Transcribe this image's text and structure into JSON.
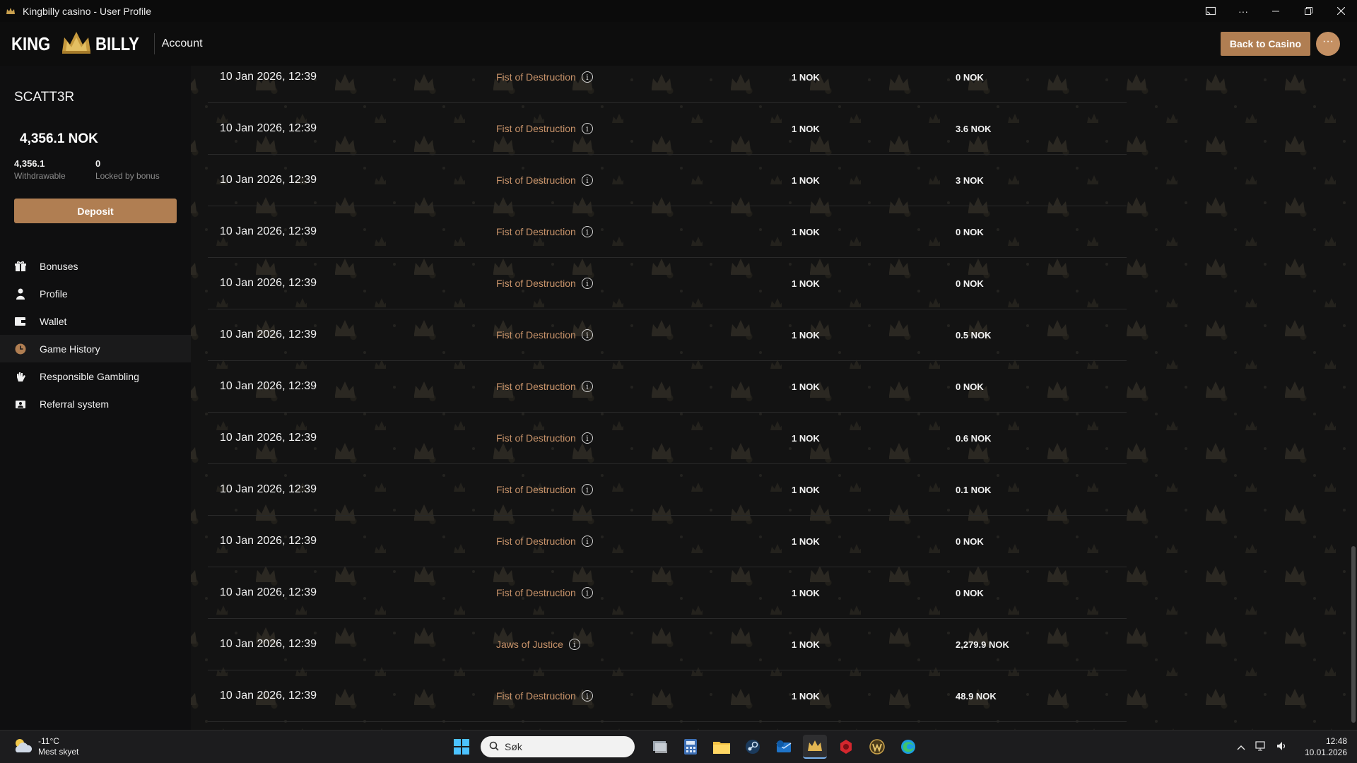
{
  "window": {
    "title": "Kingbilly casino - User Profile"
  },
  "header": {
    "logo_left": "KING",
    "logo_right": "BILLY",
    "section": "Account",
    "back_button": "Back to Casino",
    "more_button": "···"
  },
  "sidebar": {
    "username": "SCATT3R",
    "balance": "4,356.1 NOK",
    "withdrawable_value": "4,356.1",
    "withdrawable_label": "Withdrawable",
    "locked_value": "0",
    "locked_label": "Locked by bonus",
    "deposit_label": "Deposit",
    "items": [
      {
        "label": "Bonuses",
        "icon": "gift-icon"
      },
      {
        "label": "Profile",
        "icon": "user-icon"
      },
      {
        "label": "Wallet",
        "icon": "wallet-icon"
      },
      {
        "label": "Game History",
        "icon": "clock-icon",
        "active": true
      },
      {
        "label": "Responsible Gambling",
        "icon": "hand-icon"
      },
      {
        "label": "Referral system",
        "icon": "referral-icon"
      }
    ]
  },
  "history": {
    "rows": [
      {
        "date": "10 Jan 2026, 12:39",
        "game": "Fist of Destruction",
        "bet": "1 NOK",
        "win": "0 NOK"
      },
      {
        "date": "10 Jan 2026, 12:39",
        "game": "Fist of Destruction",
        "bet": "1 NOK",
        "win": "3.6 NOK"
      },
      {
        "date": "10 Jan 2026, 12:39",
        "game": "Fist of Destruction",
        "bet": "1 NOK",
        "win": "3 NOK"
      },
      {
        "date": "10 Jan 2026, 12:39",
        "game": "Fist of Destruction",
        "bet": "1 NOK",
        "win": "0 NOK"
      },
      {
        "date": "10 Jan 2026, 12:39",
        "game": "Fist of Destruction",
        "bet": "1 NOK",
        "win": "0 NOK"
      },
      {
        "date": "10 Jan 2026, 12:39",
        "game": "Fist of Destruction",
        "bet": "1 NOK",
        "win": "0.5 NOK"
      },
      {
        "date": "10 Jan 2026, 12:39",
        "game": "Fist of Destruction",
        "bet": "1 NOK",
        "win": "0 NOK"
      },
      {
        "date": "10 Jan 2026, 12:39",
        "game": "Fist of Destruction",
        "bet": "1 NOK",
        "win": "0.6 NOK"
      },
      {
        "date": "10 Jan 2026, 12:39",
        "game": "Fist of Destruction",
        "bet": "1 NOK",
        "win": "0.1 NOK"
      },
      {
        "date": "10 Jan 2026, 12:39",
        "game": "Fist of Destruction",
        "bet": "1 NOK",
        "win": "0 NOK"
      },
      {
        "date": "10 Jan 2026, 12:39",
        "game": "Fist of Destruction",
        "bet": "1 NOK",
        "win": "0 NOK"
      },
      {
        "date": "10 Jan 2026, 12:39",
        "game": "Jaws of Justice",
        "bet": "1 NOK",
        "win": "2,279.9 NOK"
      },
      {
        "date": "10 Jan 2026, 12:39",
        "game": "Fist of Destruction",
        "bet": "1 NOK",
        "win": "48.9 NOK"
      }
    ]
  },
  "taskbar": {
    "weather_temp": "-11°C",
    "weather_desc": "Mest skyet",
    "search_placeholder": "Søk",
    "time": "12:48",
    "date": "10.01.2026"
  },
  "colors": {
    "accent": "#b07e52",
    "game_link": "#c8936a"
  }
}
